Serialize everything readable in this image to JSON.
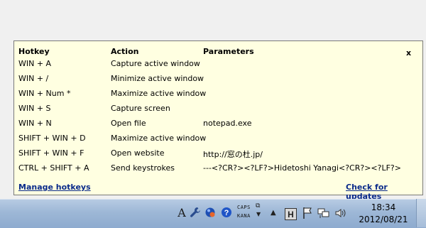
{
  "panel": {
    "headers": {
      "hotkey": "Hotkey",
      "action": "Action",
      "parameters": "Parameters"
    },
    "close_label": "x",
    "rows": [
      {
        "hotkey": "WIN + A",
        "action": "Capture active window",
        "params": ""
      },
      {
        "hotkey": "WIN + /",
        "action": "Minimize active window",
        "params": ""
      },
      {
        "hotkey": "WIN + Num *",
        "action": "Maximize active window",
        "params": ""
      },
      {
        "hotkey": "WIN + S",
        "action": "Capture screen",
        "params": ""
      },
      {
        "hotkey": "WIN + N",
        "action": "Open file",
        "params": "notepad.exe"
      },
      {
        "hotkey": "SHIFT + WIN + D",
        "action": "Maximize active window",
        "params": ""
      },
      {
        "hotkey": "SHIFT + WIN + F",
        "action": "Open website",
        "params": "http://窓の杜.jp/"
      },
      {
        "hotkey": "CTRL + SHIFT + A",
        "action": "Send keystrokes",
        "params": "---<?CR?><?LF?>Hidetoshi Yanagi<?CR?><?LF?>"
      }
    ],
    "manage_link": "Manage hotkeys",
    "update_link": "Check for updates"
  },
  "taskbar": {
    "ime_mode": "A",
    "caps": "CAPS",
    "kana": "KANA",
    "time": "18:34",
    "date": "2012/08/21",
    "tray_icons": [
      "ime-a-icon",
      "wrench-icon",
      "blue-ball-icon",
      "help-icon",
      "h-app-icon",
      "flag-icon",
      "network-icon",
      "speaker-icon"
    ]
  },
  "colors": {
    "panel_bg": "#ffffe1",
    "link": "#0a2a8a"
  }
}
